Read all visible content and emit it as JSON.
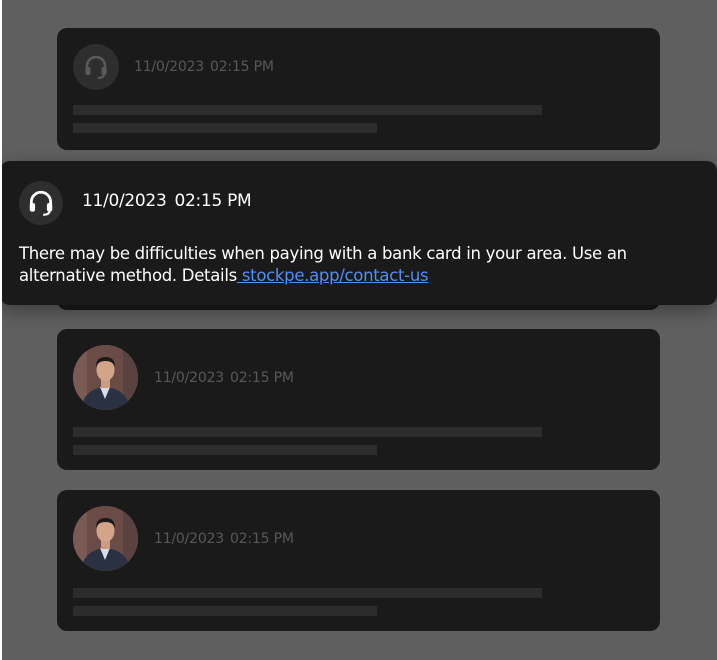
{
  "colors": {
    "overlay": "#5f5f5f",
    "card": "#1a1a1a",
    "link": "#4f8ff7",
    "muted_text": "#585858"
  },
  "notifications": [
    {
      "sender": "support",
      "date": "11/0/2023",
      "time": "02:15 PM"
    },
    {
      "sender": "user",
      "date": "11/0/2023",
      "time": "02:15 PM"
    },
    {
      "sender": "user",
      "date": "11/0/2023",
      "time": "02:15 PM"
    }
  ],
  "highlighted": {
    "sender_icon": "headset-icon",
    "date": "11/0/2023",
    "time": "02:15 PM",
    "message": "There may be difficulties when paying with a bank card in your area. Use an alternative method. Details",
    "link_text": " stockpe.app/contact-us"
  }
}
